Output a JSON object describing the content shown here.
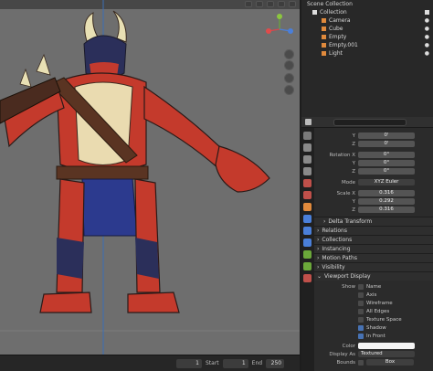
{
  "outliner": {
    "scene_label": "Scene Collection",
    "items": [
      {
        "label": "Collection",
        "indent": 0
      },
      {
        "label": "Camera",
        "indent": 1
      },
      {
        "label": "Cube",
        "indent": 1
      },
      {
        "label": "Empty",
        "indent": 1
      },
      {
        "label": "Empty.001",
        "indent": 1
      },
      {
        "label": "Light",
        "indent": 1
      }
    ]
  },
  "transform": {
    "rows": [
      {
        "label": "Y",
        "value": "0'"
      },
      {
        "label": "Z",
        "value": "0'"
      },
      {
        "label": "Rotation X",
        "value": "0°"
      },
      {
        "label": "Y",
        "value": "0°"
      },
      {
        "label": "Z",
        "value": "0°"
      },
      {
        "label": "Mode",
        "value": "XYZ Euler"
      },
      {
        "label": "Scale X",
        "value": "0.316"
      },
      {
        "label": "Y",
        "value": "0.292"
      },
      {
        "label": "Z",
        "value": "0.316"
      }
    ]
  },
  "sections": [
    "Delta Transform",
    "Relations",
    "Collections",
    "Instancing",
    "Motion Paths",
    "Visibility",
    "Viewport Display"
  ],
  "viewport_display": {
    "show_label": "Show",
    "options": [
      {
        "label": "Name",
        "checked": false
      },
      {
        "label": "Axis",
        "checked": false
      },
      {
        "label": "Wireframe",
        "checked": false
      },
      {
        "label": "All Edges",
        "checked": false
      },
      {
        "label": "Texture Space",
        "checked": false
      },
      {
        "label": "Shadow",
        "checked": true
      },
      {
        "label": "In Front",
        "checked": true
      }
    ],
    "color_label": "Color",
    "display_as_label": "Display As",
    "display_as_value": "Textured",
    "bounds_label": "Bounds",
    "bounds_value": "Box"
  },
  "timeline": {
    "current_frame": "1",
    "start_label": "Start",
    "start_value": "1",
    "end_label": "End",
    "end_value": "250"
  }
}
